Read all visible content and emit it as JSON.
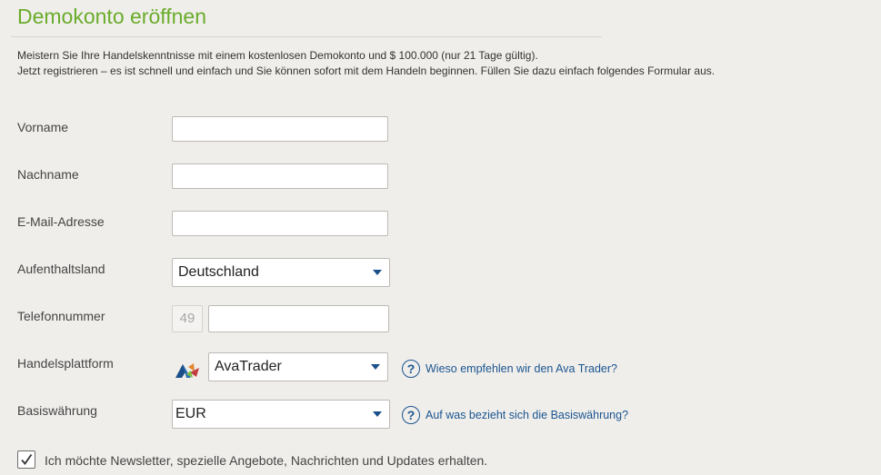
{
  "page": {
    "title": "Demokonto eröffnen",
    "intro_line1": "Meistern Sie Ihre Handelskenntnisse mit einem kostenlosen Demokonto und $ 100.000 (nur 21 Tage gültig).",
    "intro_line2": "Jetzt registrieren – es ist schnell und einfach und Sie können sofort mit dem Handeln beginnen. Füllen Sie dazu einfach folgendes Formular aus."
  },
  "form": {
    "first_name": {
      "label": "Vorname",
      "value": ""
    },
    "last_name": {
      "label": "Nachname",
      "value": ""
    },
    "email": {
      "label": "E-Mail-Adresse",
      "value": ""
    },
    "country": {
      "label": "Aufenthaltsland",
      "selected": "Deutschland"
    },
    "phone": {
      "label": "Telefonnummer",
      "prefix": "49",
      "value": ""
    },
    "platform": {
      "label": "Handelsplattform",
      "selected": "AvaTrader",
      "help_text": "Wieso empfehlen wir den Ava Trader?",
      "logo_icon": "avatrader-logo-icon"
    },
    "currency": {
      "label": "Basiswährung",
      "selected": "EUR",
      "help_text": "Auf was bezieht sich die Basiswährung?"
    },
    "newsletter": {
      "checked": true,
      "label": "Ich möchte Newsletter, spezielle Angebote, Nachrichten und Updates erhalten."
    }
  },
  "icons": {
    "help": "question-circle-icon",
    "help_glyph": "?",
    "dropdown": "caret-down-icon",
    "check": "checkmark-icon"
  },
  "colors": {
    "background": "#f0eeeb",
    "title": "#6aac2b",
    "link": "#1a5590",
    "caret": "#1a4f8a"
  }
}
